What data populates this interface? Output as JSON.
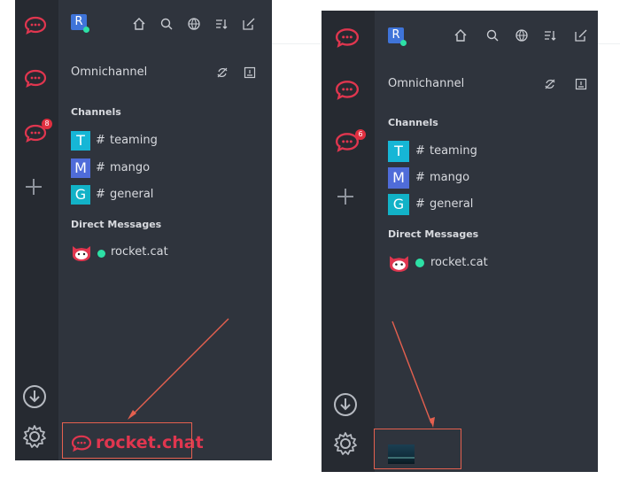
{
  "left": {
    "user_initial": "R",
    "omnichannel_label": "Omnichannel",
    "channels_header": "Channels",
    "channels": [
      {
        "initial": "T",
        "name": "teaming",
        "color": "#16b6d6"
      },
      {
        "initial": "M",
        "name": "mango",
        "color": "#4f6cd9"
      },
      {
        "initial": "G",
        "name": "general",
        "color": "#12b2c7"
      }
    ],
    "dm_header": "Direct Messages",
    "dm": {
      "name": "rocket.cat"
    },
    "badge": "8",
    "brand_logo": "rocket.chat"
  },
  "right": {
    "user_initial": "R",
    "omnichannel_label": "Omnichannel",
    "channels_header": "Channels",
    "channels": [
      {
        "initial": "T",
        "name": "teaming",
        "color": "#16b6d6"
      },
      {
        "initial": "M",
        "name": "mango",
        "color": "#4f6cd9"
      },
      {
        "initial": "G",
        "name": "general",
        "color": "#12b2c7"
      }
    ],
    "dm_header": "Direct Messages",
    "dm": {
      "name": "rocket.cat"
    },
    "badge": "6"
  },
  "colors": {
    "accent_red": "#e0364f",
    "online_green": "#2de0a5",
    "annotation": "#e5604f"
  }
}
